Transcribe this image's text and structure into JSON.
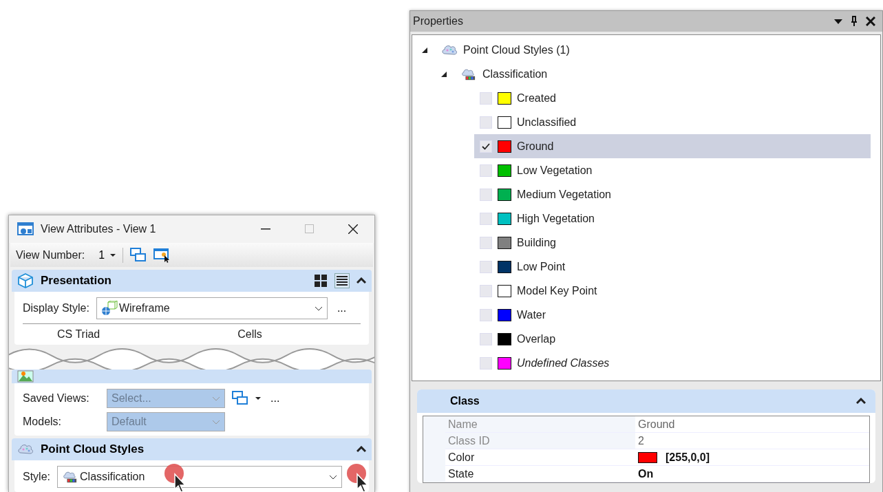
{
  "view_attributes": {
    "title": "View Attributes - View 1",
    "view_number_label": "View Number:",
    "view_number": "1",
    "presentation": {
      "title": "Presentation",
      "expanded": true,
      "display_style_label": "Display Style:",
      "display_style": "Wireframe",
      "more": "...",
      "fragments": [
        "CS Triad",
        "Cells"
      ]
    },
    "saved_views": {
      "saved_views_label": "Saved Views:",
      "saved_views_placeholder": "Select...",
      "more": "...",
      "models_label": "Models:",
      "models_value": "Default"
    },
    "point_cloud_styles": {
      "title": "Point Cloud Styles",
      "expanded": true,
      "style_label": "Style:",
      "style_value": "Classification"
    }
  },
  "properties": {
    "title": "Properties",
    "tree": [
      {
        "label": "Point Cloud Styles (1)",
        "expanded": true,
        "children": [
          {
            "label": "Classification",
            "expanded": true,
            "children": [
              {
                "label": "Created",
                "kind": "class",
                "checked": false,
                "selected": false,
                "color": "#ffff00"
              },
              {
                "label": "Unclassified",
                "kind": "class",
                "checked": false,
                "selected": false,
                "color": "#ffffff"
              },
              {
                "label": "Ground",
                "kind": "class",
                "checked": true,
                "selected": true,
                "color": "#ff0000"
              },
              {
                "label": "Low Vegetation",
                "kind": "class",
                "checked": false,
                "selected": false,
                "color": "#00c000"
              },
              {
                "label": "Medium Vegetation",
                "kind": "class",
                "checked": false,
                "selected": false,
                "color": "#00b050"
              },
              {
                "label": "High Vegetation",
                "kind": "class",
                "checked": false,
                "selected": false,
                "color": "#00c0c0"
              },
              {
                "label": "Building",
                "kind": "class",
                "checked": false,
                "selected": false,
                "color": "#808080"
              },
              {
                "label": "Low Point",
                "kind": "class",
                "checked": false,
                "selected": false,
                "color": "#003366"
              },
              {
                "label": "Model Key Point",
                "kind": "class",
                "checked": false,
                "selected": false,
                "color": "#ffffff"
              },
              {
                "label": "Water",
                "kind": "class",
                "checked": false,
                "selected": false,
                "color": "#0000ff"
              },
              {
                "label": "Overlap",
                "kind": "class",
                "checked": false,
                "selected": false,
                "color": "#000000"
              },
              {
                "label": "Undefined Classes",
                "kind": "undefined",
                "checked": false,
                "selected": false,
                "color": "#ff00ff"
              }
            ]
          }
        ]
      }
    ],
    "class_group": {
      "title": "Class",
      "expanded": true,
      "rows": [
        {
          "name": "Name",
          "value": "Ground",
          "readonly": true
        },
        {
          "name": "Class ID",
          "value": "2",
          "readonly": true
        },
        {
          "name": "Color",
          "value": "[255,0,0]",
          "readonly": false,
          "color": "#ff0000"
        },
        {
          "name": "State",
          "value": "On",
          "readonly": false
        }
      ]
    }
  }
}
